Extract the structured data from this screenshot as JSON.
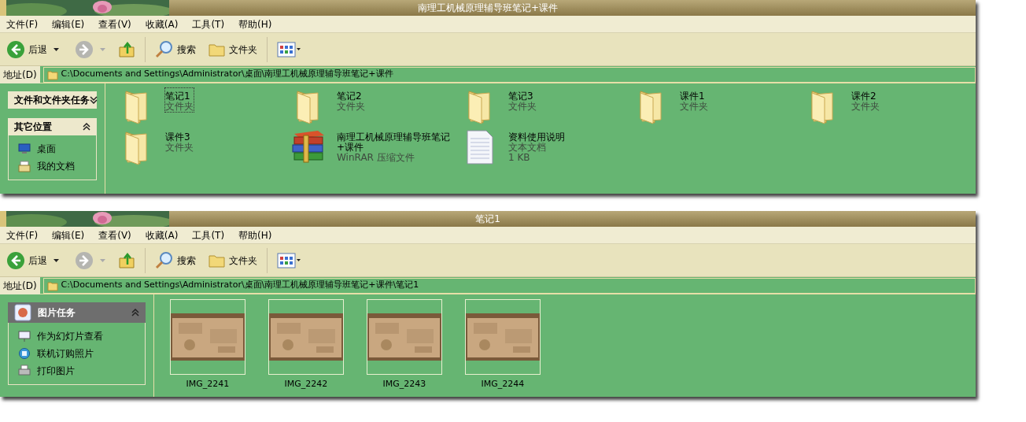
{
  "windows": [
    {
      "title": "南理工机械原理辅导班笔记+课件",
      "menu": [
        "文件(F)",
        "编辑(E)",
        "查看(V)",
        "收藏(A)",
        "工具(T)",
        "帮助(H)"
      ],
      "toolbar": {
        "back": {
          "label": "后退",
          "disabled": false
        },
        "forward": {
          "disabled": true
        },
        "search": "搜索",
        "folders": "文件夹"
      },
      "address": {
        "label": "地址(D)",
        "path": "C:\\Documents and Settings\\Administrator\\桌面\\南理工机械原理辅导班笔记+课件"
      },
      "sidebar": [
        {
          "title": "文件和文件夹任务",
          "expanded": false,
          "kind": "plain"
        },
        {
          "title": "其它位置",
          "expanded": true,
          "kind": "plain",
          "items": [
            {
              "label": "桌面",
              "kind": "desktop"
            },
            {
              "label": "我的文档",
              "kind": "documents"
            }
          ]
        }
      ],
      "items": [
        {
          "kind": "folder",
          "name": "笔记1",
          "type": "文件夹",
          "selected": true
        },
        {
          "kind": "folder",
          "name": "笔记2",
          "type": "文件夹",
          "selected": false
        },
        {
          "kind": "folder",
          "name": "笔记3",
          "type": "文件夹",
          "selected": false
        },
        {
          "kind": "folder",
          "name": "课件1",
          "type": "文件夹",
          "selected": false
        },
        {
          "kind": "folder",
          "name": "课件2",
          "type": "文件夹",
          "selected": false
        },
        {
          "kind": "folder",
          "name": "课件3",
          "type": "文件夹",
          "selected": false
        },
        {
          "kind": "archive",
          "name": "南理工机械原理辅导班笔记+课件",
          "type": "WinRAR 压缩文件",
          "selected": false
        },
        {
          "kind": "document",
          "name": "资料使用说明",
          "type": "文本文档",
          "size": "1 KB",
          "selected": false
        }
      ]
    },
    {
      "title": "笔记1",
      "menu": [
        "文件(F)",
        "编辑(E)",
        "查看(V)",
        "收藏(A)",
        "工具(T)",
        "帮助(H)"
      ],
      "toolbar": {
        "back": {
          "label": "后退",
          "disabled": false
        },
        "forward": {
          "disabled": true
        },
        "search": "搜索",
        "folders": "文件夹"
      },
      "address": {
        "label": "地址(D)",
        "path": "C:\\Documents and Settings\\Administrator\\桌面\\南理工机械原理辅导班笔记+课件\\笔记1"
      },
      "sidebar": [
        {
          "title": "图片任务",
          "expanded": true,
          "kind": "dark",
          "items": [
            {
              "label": "作为幻灯片查看",
              "kind": "slideshow"
            },
            {
              "label": "联机订购照片",
              "kind": "order"
            },
            {
              "label": "打印图片",
              "kind": "print"
            }
          ]
        }
      ],
      "items": [
        {
          "name": "IMG_2241",
          "selected": false
        },
        {
          "name": "IMG_2242",
          "selected": false
        },
        {
          "name": "IMG_2243",
          "selected": false
        },
        {
          "name": "IMG_2244",
          "selected": false
        }
      ]
    }
  ]
}
